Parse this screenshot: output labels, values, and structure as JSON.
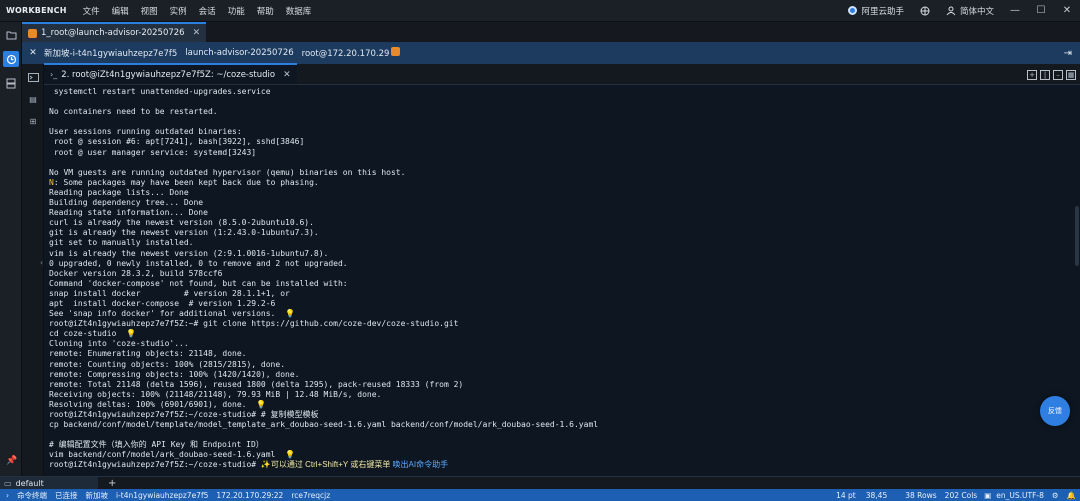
{
  "menubar": {
    "brand": "WORKBENCH",
    "items": [
      "文件",
      "编辑",
      "视图",
      "实例",
      "会话",
      "功能",
      "帮助",
      "数据库"
    ],
    "assistant_label": "阿里云助手",
    "language_label": "简体中文"
  },
  "tabs": {
    "session_tab": "1_root@launch-advisor-20250726",
    "terminal_tab": "2. root@iZt4n1gywiauhzepz7e7f5Z: ~/coze-studio",
    "bottom_tab": "default"
  },
  "connection": {
    "instance_prefix": "新加坡",
    "instance_id": "i-t4n1gywiauhzepz7e7f5",
    "instance_name": "launch-advisor-20250726",
    "login": "root@172.20.170.29"
  },
  "terminal": {
    "lines": [
      " systemctl restart unattended-upgrades.service",
      "",
      "No containers need to be restarted.",
      "",
      "User sessions running outdated binaries:",
      " root @ session #6: apt[7241], bash[3922], sshd[3846]",
      " root @ user manager service: systemd[3243]",
      "",
      "No VM guests are running outdated hypervisor (qemu) binaries on this host.",
      "N: Some packages may have been kept back due to phasing.",
      "Reading package lists... Done",
      "Building dependency tree... Done",
      "Reading state information... Done",
      "curl is already the newest version (8.5.0-2ubuntu10.6).",
      "git is already the newest version (1:2.43.0-1ubuntu7.3).",
      "git set to manually installed.",
      "vim is already the newest version (2:9.1.0016-1ubuntu7.8).",
      "0 upgraded, 0 newly installed, 0 to remove and 2 not upgraded.",
      "Docker version 28.3.2, build 578ccf6",
      "Command 'docker-compose' not found, but can be installed with:",
      "snap install docker         # version 28.1.1+1, or",
      "apt  install docker-compose  # version 1.29.2-6",
      "See 'snap info docker' for additional versions.",
      "root@iZt4n1gywiauhzepz7e7f5Z:~# git clone https://github.com/coze-dev/coze-studio.git",
      "cd coze-studio",
      "Cloning into 'coze-studio'...",
      "remote: Enumerating objects: 21148, done.",
      "remote: Counting objects: 100% (2815/2815), done.",
      "remote: Compressing objects: 100% (1420/1420), done.",
      "remote: Total 21148 (delta 1596), reused 1800 (delta 1295), pack-reused 18333 (from 2)",
      "Receiving objects: 100% (21148/21148), 79.93 MiB | 12.48 MiB/s, done.",
      "Resolving deltas: 100% (6901/6901), done.",
      "root@iZt4n1gywiauhzepz7e7f5Z:~/coze-studio# # 复制模型模板",
      "cp backend/conf/model/template/model_template_ark_doubao-seed-1.6.yaml backend/conf/model/ark_doubao-seed-1.6.yaml",
      "",
      "# 编辑配置文件（填入你的 API Key 和 Endpoint ID）",
      "vim backend/conf/model/ark_doubao-seed-1.6.yaml",
      "root@iZt4n1gywiauhzepz7e7f5Z:~/coze-studio# "
    ],
    "hint_text": "可以通过 Ctrl+Shift+Y 或右键菜单",
    "hint_link": "唤出AI命令助手"
  },
  "chat_bubble_label": "反馈",
  "statusbar": {
    "cmd_terminal": "命令终端",
    "connected": "已连接",
    "new_connection": "新加坡",
    "instance_id": "i-t4n1gywiauhzepz7e7f5",
    "ip": "172.20.170.29:22",
    "session_id": "rce7reqcjz",
    "font_size": "14 pt",
    "cursor_pos": "38,45",
    "rows": "38 Rows",
    "cols": "202 Cols",
    "encoding": "en_US.UTF-8"
  },
  "colors": {
    "accent": "#2b7fe0",
    "connbar": "#1d3b5f",
    "statusbar": "#1c5fb3",
    "terminal_bg": "#0d1621"
  }
}
